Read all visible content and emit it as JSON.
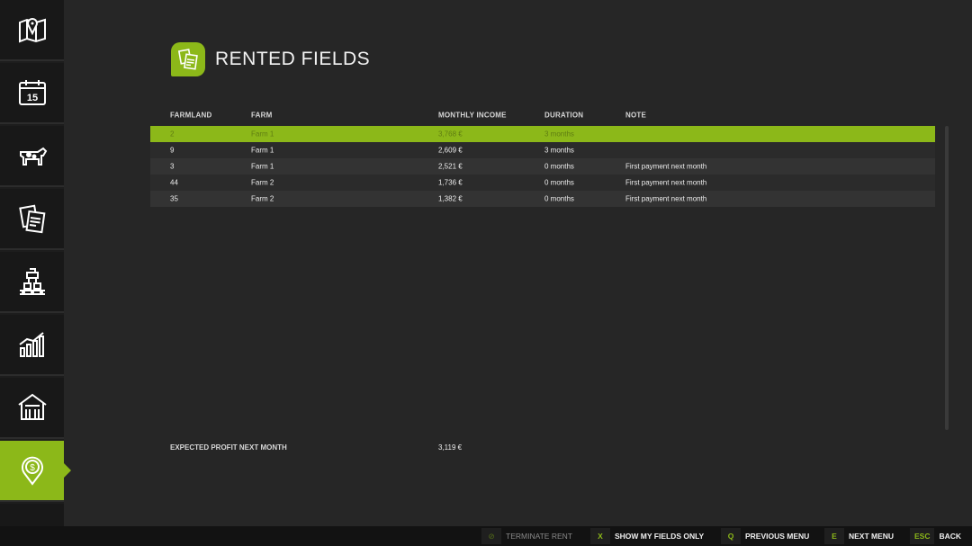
{
  "page": {
    "title": "RENTED FIELDS"
  },
  "sidebar": {
    "items": [
      {
        "icon": "map-icon"
      },
      {
        "icon": "calendar-icon",
        "day": "15"
      },
      {
        "icon": "cow-icon"
      },
      {
        "icon": "contracts-icon"
      },
      {
        "icon": "production-icon"
      },
      {
        "icon": "statistics-icon"
      },
      {
        "icon": "barn-icon"
      },
      {
        "icon": "money-pin-icon",
        "active": true
      },
      {
        "icon": "more-icon"
      }
    ]
  },
  "table": {
    "headers": [
      "FARMLAND",
      "FARM",
      "MONTHLY INCOME",
      "DURATION",
      "NOTE"
    ],
    "rows": [
      {
        "farmland": "2",
        "farm": "Farm 1",
        "income": "3,768 €",
        "duration": "3 months",
        "note": ""
      },
      {
        "farmland": "9",
        "farm": "Farm 1",
        "income": "2,609 €",
        "duration": "3 months",
        "note": ""
      },
      {
        "farmland": "3",
        "farm": "Farm 1",
        "income": "2,521 €",
        "duration": "0 months",
        "note": "First payment next month"
      },
      {
        "farmland": "44",
        "farm": "Farm 2",
        "income": "1,736 €",
        "duration": "0 months",
        "note": "First payment next month"
      },
      {
        "farmland": "35",
        "farm": "Farm 2",
        "income": "1,382 €",
        "duration": "0 months",
        "note": "First payment next month"
      }
    ]
  },
  "summary": {
    "label": "EXPECTED PROFIT NEXT MONTH",
    "value": "3,119 €"
  },
  "bottombar": {
    "terminate": {
      "key": "⊘",
      "label": "TERMINATE RENT"
    },
    "show_fields": {
      "key": "X",
      "label": "SHOW MY FIELDS ONLY"
    },
    "previous": {
      "key": "Q",
      "label": "PREVIOUS MENU"
    },
    "next": {
      "key": "E",
      "label": "NEXT MENU"
    },
    "back": {
      "key": "ESC",
      "label": "BACK"
    }
  },
  "colors": {
    "accent": "#8cb819",
    "background": "#262626",
    "sidebar": "#181818"
  }
}
